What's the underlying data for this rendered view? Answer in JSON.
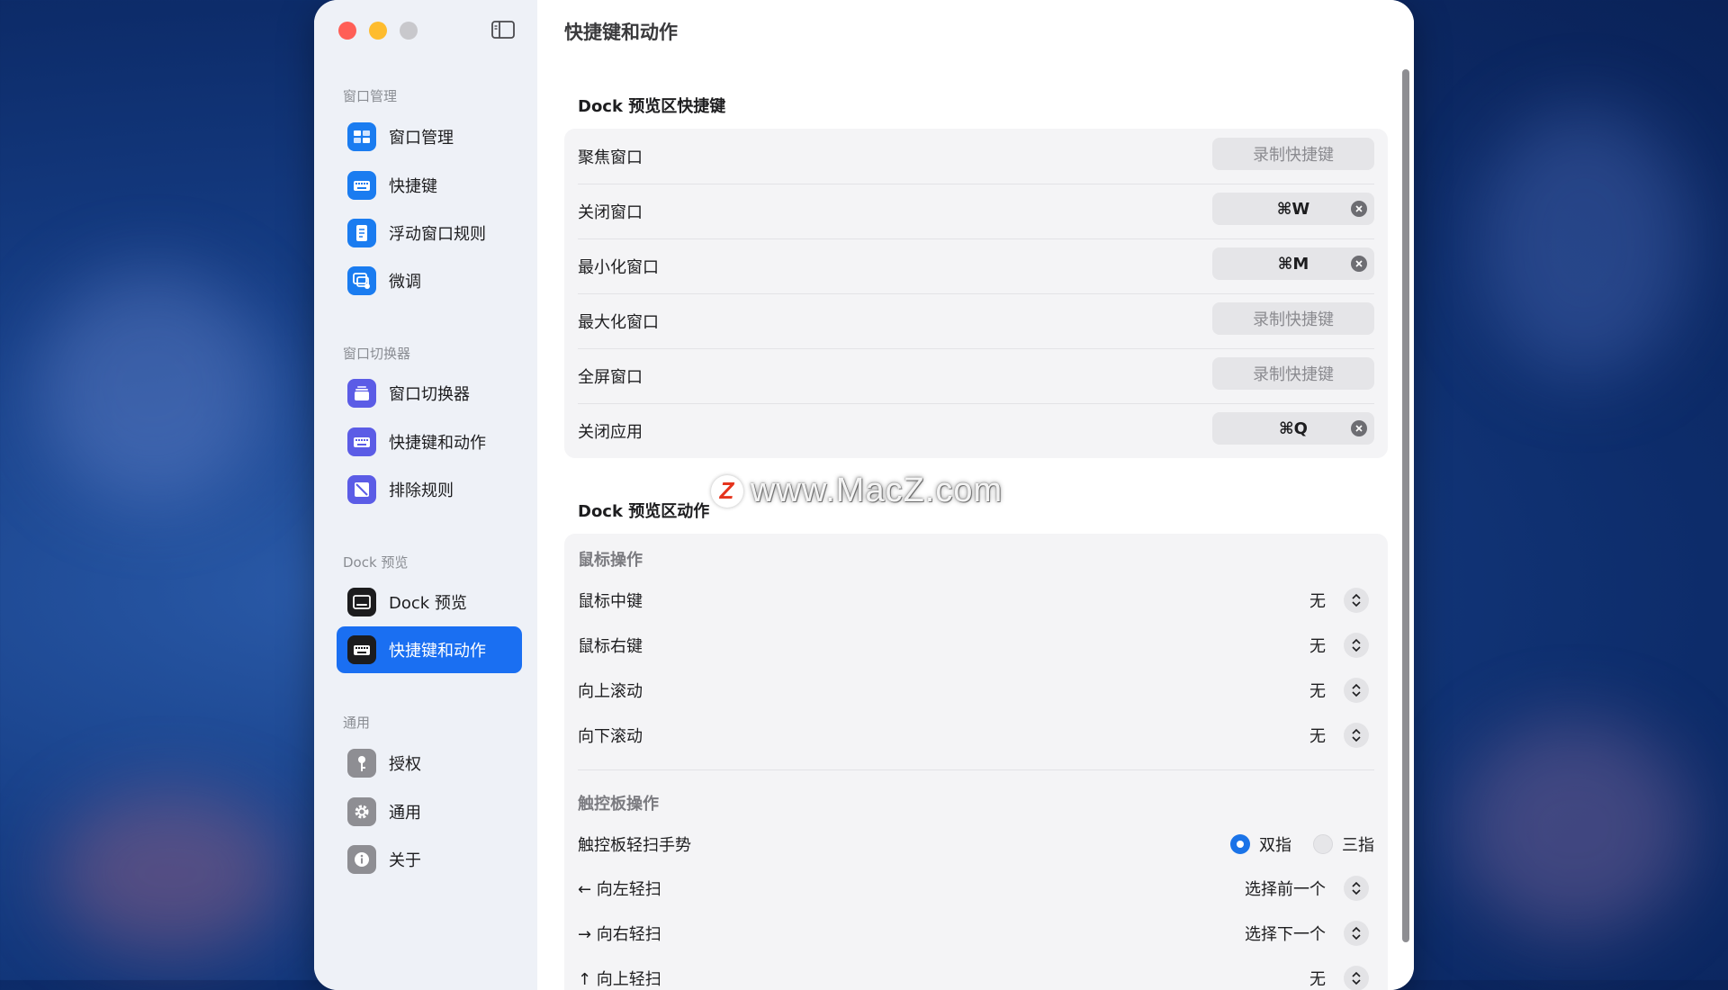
{
  "sidebar": {
    "sections": [
      {
        "title": "窗口管理",
        "items": [
          {
            "label": "窗口管理",
            "icon": "window-grid-icon",
            "color": "#1a7cf0"
          },
          {
            "label": "快捷键",
            "icon": "keyboard-icon",
            "color": "#1a7cf0"
          },
          {
            "label": "浮动窗口规则",
            "icon": "document-icon",
            "color": "#1a7cf0"
          },
          {
            "label": "微调",
            "icon": "window-gear-icon",
            "color": "#1a7cf0"
          }
        ]
      },
      {
        "title": "窗口切换器",
        "items": [
          {
            "label": "窗口切换器",
            "icon": "stack-icon",
            "color": "#5b5ce6"
          },
          {
            "label": "快捷键和动作",
            "icon": "keyboard-icon",
            "color": "#5b5ce6"
          },
          {
            "label": "排除规则",
            "icon": "exclude-icon",
            "color": "#5b5ce6"
          }
        ]
      },
      {
        "title": "Dock 预览",
        "items": [
          {
            "label": "Dock 预览",
            "icon": "dock-icon",
            "color": "#1c1c1e"
          },
          {
            "label": "快捷键和动作",
            "icon": "keyboard-icon",
            "color": "#1c1c1e",
            "active": true
          }
        ]
      },
      {
        "title": "通用",
        "items": [
          {
            "label": "授权",
            "icon": "key-icon",
            "color": "#8e8e93"
          },
          {
            "label": "通用",
            "icon": "gear-icon",
            "color": "#8e8e93"
          },
          {
            "label": "关于",
            "icon": "info-icon",
            "color": "#8e8e93"
          }
        ]
      }
    ]
  },
  "main": {
    "title": "快捷键和动作",
    "shortcuts_group": {
      "title": "Dock 预览区快捷键",
      "rows": [
        {
          "label": "聚焦窗口",
          "value": "录制快捷键",
          "set": false
        },
        {
          "label": "关闭窗口",
          "value": "⌘W",
          "set": true
        },
        {
          "label": "最小化窗口",
          "value": "⌘M",
          "set": true
        },
        {
          "label": "最大化窗口",
          "value": "录制快捷键",
          "set": false
        },
        {
          "label": "全屏窗口",
          "value": "录制快捷键",
          "set": false
        },
        {
          "label": "关闭应用",
          "value": "⌘Q",
          "set": true
        }
      ]
    },
    "actions_group": {
      "title": "Dock 预览区动作",
      "mouse_title": "鼠标操作",
      "mouse_rows": [
        {
          "label": "鼠标中键",
          "value": "无"
        },
        {
          "label": "鼠标右键",
          "value": "无"
        },
        {
          "label": "向上滚动",
          "value": "无"
        },
        {
          "label": "向下滚动",
          "value": "无"
        }
      ],
      "trackpad_title": "触控板操作",
      "gesture_label": "触控板轻扫手势",
      "gesture_options": [
        "双指",
        "三指"
      ],
      "gesture_selected": "双指",
      "trackpad_rows": [
        {
          "label": "← 向左轻扫",
          "value": "选择前一个"
        },
        {
          "label": "→ 向右轻扫",
          "value": "选择下一个"
        },
        {
          "label": "↑ 向上轻扫",
          "value": "无"
        }
      ]
    }
  },
  "watermark": {
    "badge": "Z",
    "text": "www.MacZ.com"
  },
  "colors": {
    "accent": "#1a6ff2",
    "close": "#ff5f57",
    "minimize": "#febc2e",
    "zoom_disabled": "#c8c8cc"
  }
}
